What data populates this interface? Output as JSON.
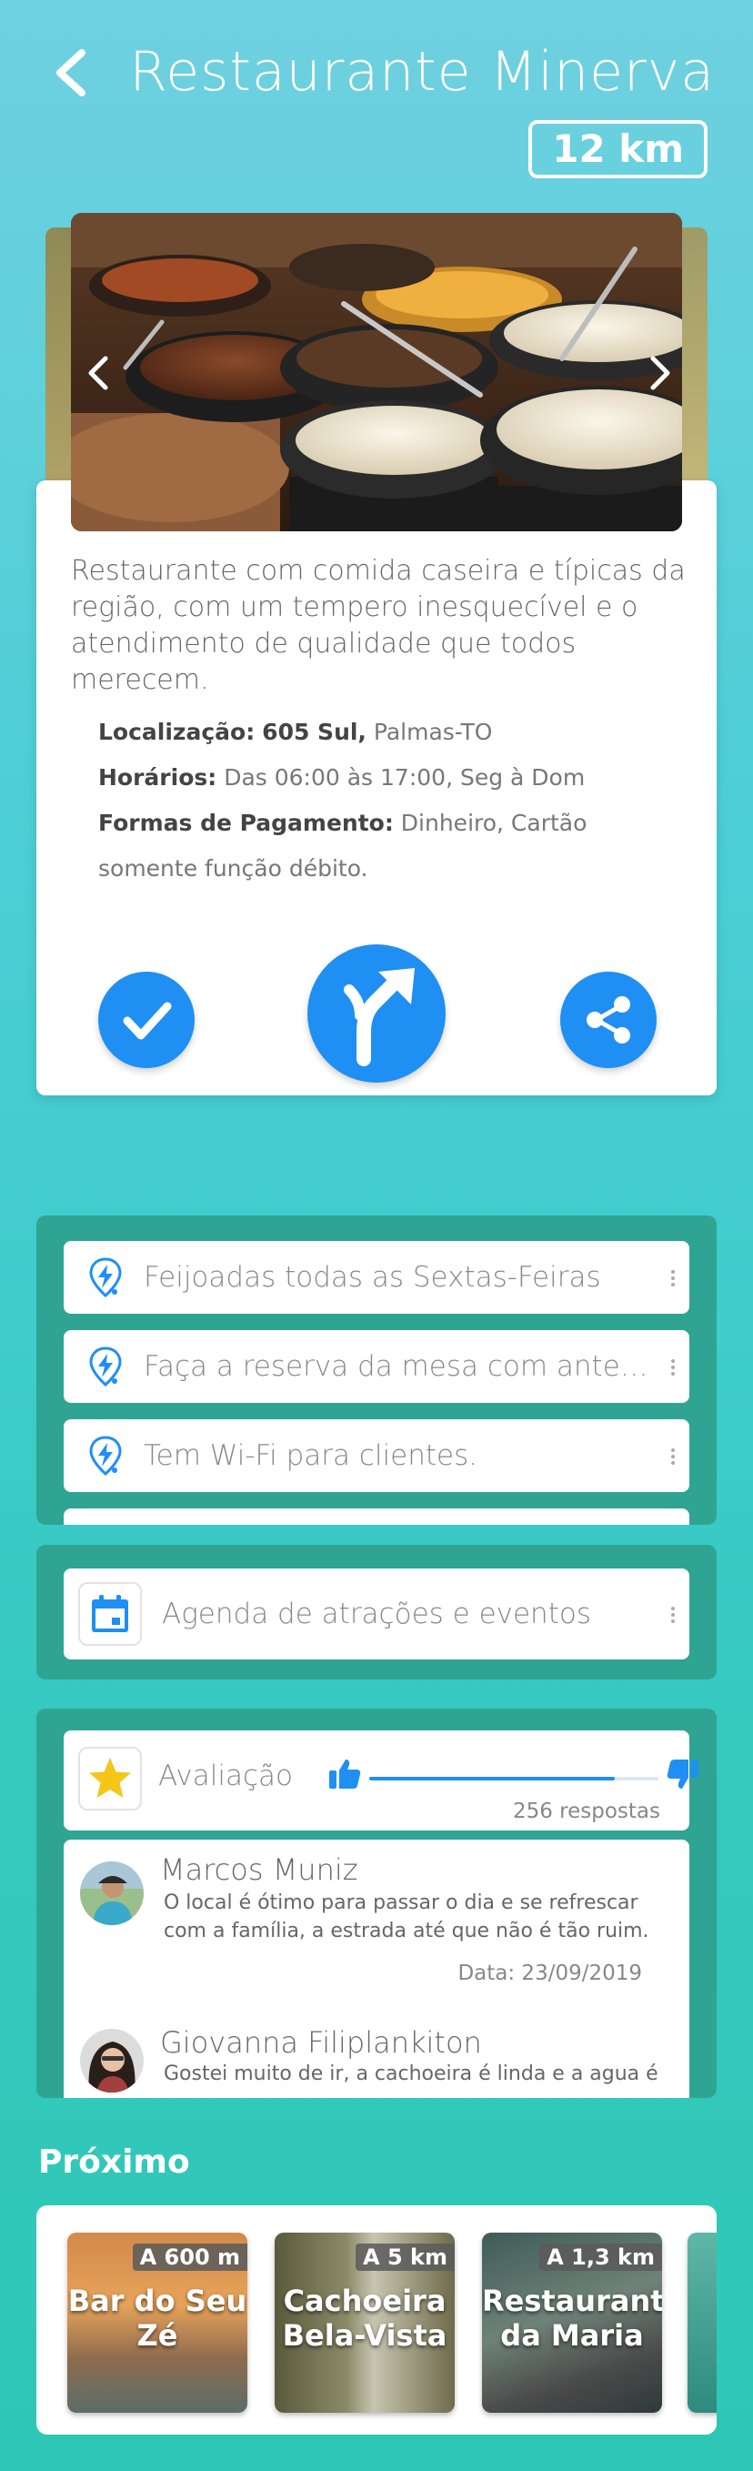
{
  "header": {
    "title": "Restaurante Minerva",
    "distance": "12 km"
  },
  "place": {
    "description": "Restaurante com comida caseira e típicas da região, com um tempero inesquecível e o atendimento de qualidade que todos merecem.",
    "location_label": "Localização:",
    "location_bold": "605 Sul,",
    "location_city": "Palmas-TO",
    "hours_label": "Horários:",
    "hours_value": "Das 06:00 às 17:00, Seg à Dom",
    "payment_label": "Formas de Pagamento:",
    "payment_value": "Dinheiro, Cartão somente função débito."
  },
  "tips": [
    {
      "text": "Feijoadas todas as Sextas-Feiras"
    },
    {
      "text": "Faça a reserva da mesa com antecedência"
    },
    {
      "text": "Tem Wi-Fi para clientes."
    }
  ],
  "events": {
    "label": "Agenda de atrações e eventos"
  },
  "rating": {
    "label": "Avaliação",
    "approval_fraction": 0.85,
    "responses": "256 respostas"
  },
  "comments": [
    {
      "name": "Marcos Muniz",
      "text": "O local é ótimo para passar o dia e se refrescar com a família, a estrada até que não é tão ruim.",
      "date": "Data: 23/09/2019"
    },
    {
      "name": "Giovanna Filiplankiton",
      "text": "Gostei muito de ir, a cachoeira é linda e a agua é",
      "date": ""
    }
  ],
  "nearby": {
    "title": "Próximo",
    "places": [
      {
        "name": "Bar do Seu Zé",
        "distance": "A 600 m"
      },
      {
        "name": "Cachoeira Bela-Vista",
        "distance": "A 5 km"
      },
      {
        "name": "Restaurante da Maria",
        "distance": "A 1,3 km"
      }
    ]
  },
  "colors": {
    "accent": "#1f8ff3",
    "panel": "#2fa493",
    "background_top": "#6fd0e0",
    "background_bottom": "#2ec7b5"
  },
  "icons": {
    "back": "chevron-left-icon",
    "checkin": "check-icon",
    "route": "route-arrow-icon",
    "share": "share-icon",
    "tip": "lightning-pin-icon",
    "events": "calendar-icon",
    "rating": "star-icon",
    "like": "thumbs-up-icon",
    "dislike": "thumbs-down-icon"
  }
}
